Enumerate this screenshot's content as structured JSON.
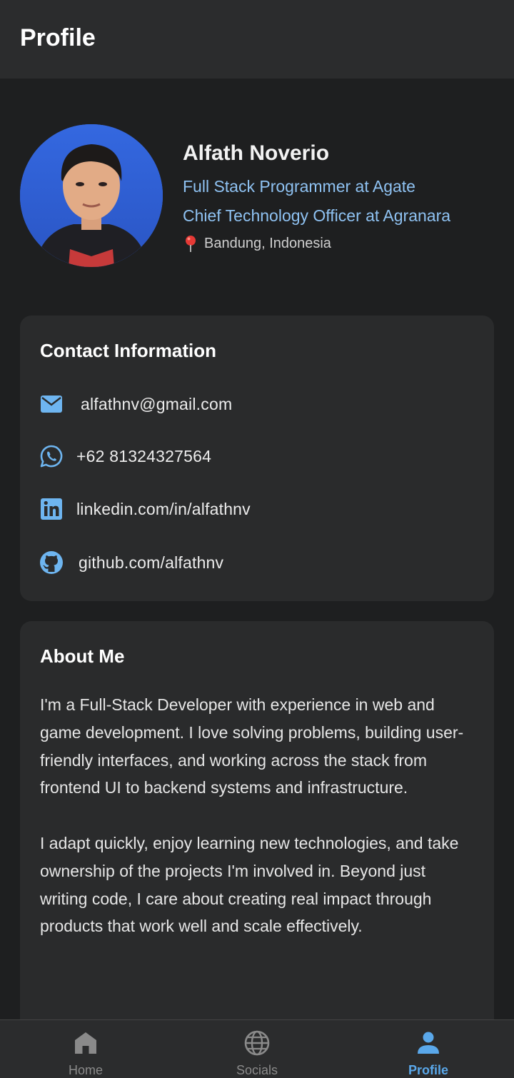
{
  "appbar": {
    "title": "Profile"
  },
  "profile": {
    "name": "Alfath Noverio",
    "roles": [
      "Full Stack Programmer at Agate",
      "Chief Technology Officer at Agranara"
    ],
    "location": "Bandung, Indonesia"
  },
  "contact": {
    "title": "Contact Information",
    "items": [
      {
        "icon": "email-icon",
        "text": "alfathnv@gmail.com"
      },
      {
        "icon": "whatsapp-icon",
        "text": "+62 81324327564"
      },
      {
        "icon": "linkedin-icon",
        "text": "linkedin.com/in/alfathnv"
      },
      {
        "icon": "github-icon",
        "text": "github.com/alfathnv"
      }
    ]
  },
  "about": {
    "title": "About Me",
    "paragraphs": [
      "I'm a Full-Stack Developer with experience in web and game development. I love solving problems, building user-friendly interfaces, and working across the stack from frontend UI to backend systems and infrastructure.",
      "I adapt quickly, enjoy learning new technologies, and take ownership of the projects I'm involved in. Beyond just writing code, I care about creating real impact through products that work well and scale effectively."
    ]
  },
  "nav": {
    "items": [
      {
        "label": "Home",
        "icon": "home-icon",
        "active": false
      },
      {
        "label": "Socials",
        "icon": "globe-icon",
        "active": false
      },
      {
        "label": "Profile",
        "icon": "person-icon",
        "active": true
      }
    ]
  },
  "colors": {
    "background": "#1e1f20",
    "card": "#2a2b2c",
    "accent": "#5aa8ea",
    "link": "#8fc2f2"
  }
}
